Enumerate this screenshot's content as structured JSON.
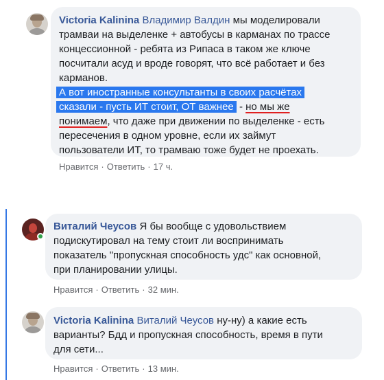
{
  "comments": [
    {
      "author": "Victoria Kalinina",
      "mention": "Владимир Валдин",
      "lines": [
        "мы моделировали",
        "трамваи на выделенке + автобусы в карманах по трассе",
        "концессионной - ребята из Рипаса в таком же ключе",
        "посчитали асуд и вроде говорят, что всё работает и без",
        "карманов."
      ],
      "highlight_lines": [
        "А вот иностранные консультанты в своих расчётах",
        "сказали - пусть ИТ стоит, ОТ важнее"
      ],
      "line7_dash": " - ",
      "line7_underline": "но мы же",
      "line8_underline": "понимаем",
      "line8_rest": ", что даже при движении по выделенке - есть",
      "tail_lines": [
        "пересечения в одном уровне, если их займут",
        "пользователи ИТ, то трамваю тоже будет не проехать."
      ],
      "like": "Нравится",
      "reply": "Ответить",
      "dot": "·",
      "time": "17 ч."
    },
    {
      "author": "Виталий Чеусов",
      "lines": [
        "Я бы вообще с удовольствием",
        "подискутировал на тему стоит ли воспринимать",
        "показатель \"пропускная способность удс\" как основной,",
        "при планировании улицы."
      ],
      "like": "Нравится",
      "reply": "Ответить",
      "dot": "·",
      "time": "32 мин."
    },
    {
      "author": "Victoria Kalinina",
      "mention": "Виталий Чеусов",
      "lines": [
        "ну-ну) а какие есть",
        "варианты? Бдд и пропускная способность, время в пути",
        "для сети..."
      ],
      "like": "Нравится",
      "reply": "Ответить",
      "dot": "·",
      "time": "13 мин."
    }
  ],
  "colors": {
    "bubble": "#f0f2f5",
    "name": "#385898",
    "highlight": "#2a78ee",
    "underline": "#e02020",
    "thread_line": "#3578e5",
    "online": "#31a24c"
  }
}
